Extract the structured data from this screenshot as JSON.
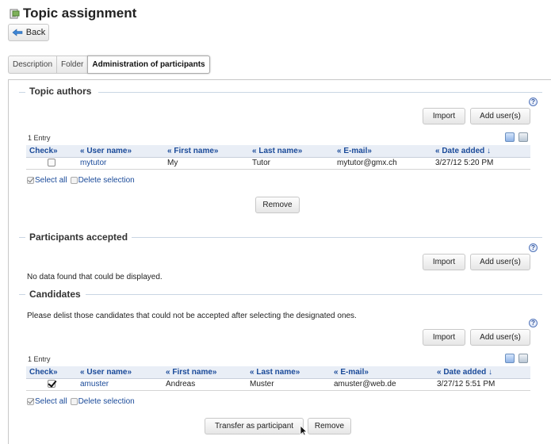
{
  "header": {
    "title": "Topic assignment",
    "back_label": "Back"
  },
  "tabs": [
    {
      "label": "Description",
      "active": false
    },
    {
      "label": "Folder",
      "active": false
    },
    {
      "label": "Administration of participants",
      "active": true
    }
  ],
  "authors": {
    "legend": "Topic authors",
    "import_label": "Import",
    "add_label": "Add user(s)",
    "entry_count": "1 Entry",
    "columns": [
      "Check»",
      "« User name»",
      "« First name»",
      "« Last name»",
      "« E-mail»",
      "« Date added ↓"
    ],
    "rows": [
      {
        "checked": false,
        "username": "mytutor",
        "first": "My",
        "last": "Tutor",
        "email": "mytutor@gmx.ch",
        "date": "3/27/12 5:20 PM"
      }
    ],
    "select_all": "Select all",
    "delete_selection": "Delete selection",
    "remove_label": "Remove"
  },
  "accepted": {
    "legend": "Participants accepted",
    "import_label": "Import",
    "add_label": "Add user(s)",
    "empty_text": "No data found that could be displayed."
  },
  "candidates": {
    "legend": "Candidates",
    "info_text": "Please delist those candidates that could not be accepted after selecting the designated ones.",
    "import_label": "Import",
    "add_label": "Add user(s)",
    "entry_count": "1 Entry",
    "columns": [
      "Check»",
      "« User name»",
      "« First name»",
      "« Last name»",
      "« E-mail»",
      "« Date added ↓"
    ],
    "rows": [
      {
        "checked": true,
        "username": "amuster",
        "first": "Andreas",
        "last": "Muster",
        "email": "amuster@web.de",
        "date": "3/27/12 5:51 PM"
      }
    ],
    "select_all": "Select all",
    "delete_selection": "Delete selection",
    "transfer_label": "Transfer as participant",
    "remove_label": "Remove"
  },
  "colors": {
    "link": "#1a4a99",
    "header_bg": "#e9eef6",
    "legend_line": "#c9d6e3"
  },
  "icons": [
    "topic-icon",
    "back-arrow-icon",
    "help-icon",
    "table-config-icon",
    "table-export-icon",
    "mouse-cursor-icon"
  ]
}
